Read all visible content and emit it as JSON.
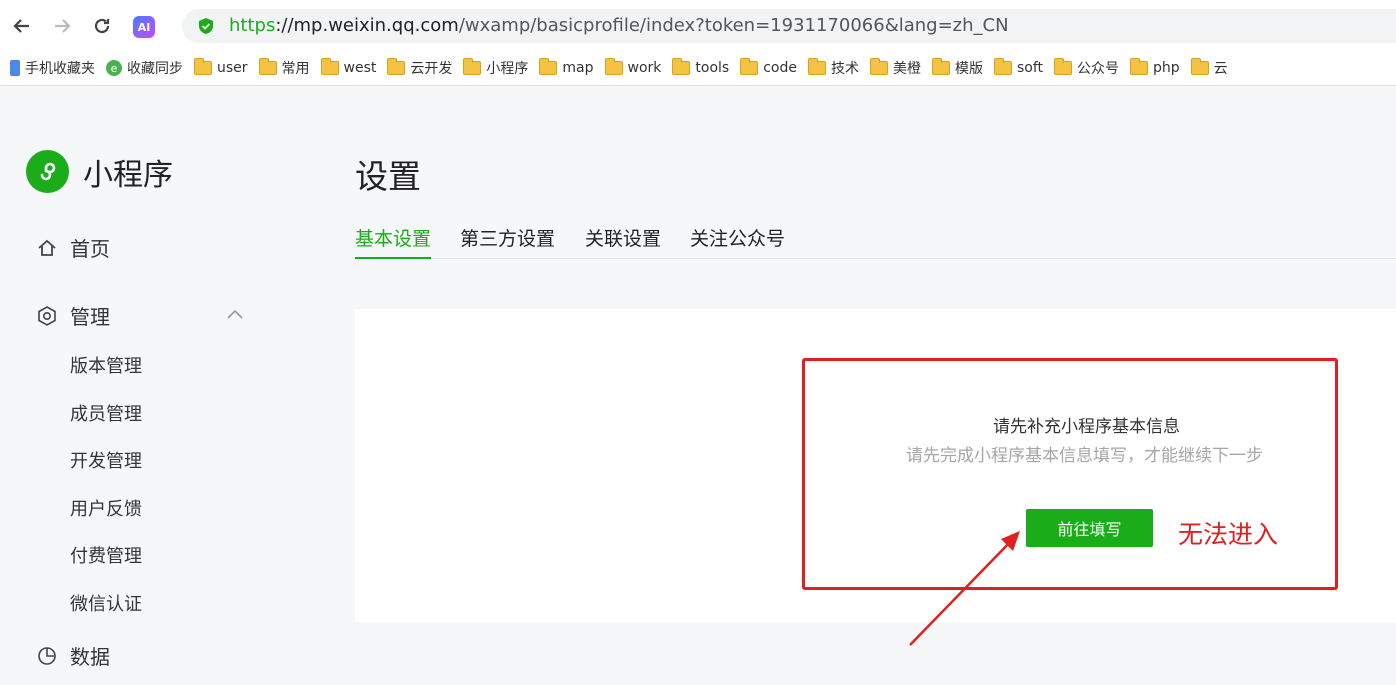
{
  "browser": {
    "url_scheme": "https",
    "url_rest_host": "://mp.weixin.qq.com",
    "url_path": "/wxamp/basicprofile/index?token=1931170066&lang=zh_CN",
    "ai_badge": "AI",
    "bookmarks": [
      {
        "label": "手机收藏夹",
        "icon": "phone-icon"
      },
      {
        "label": "收藏同步",
        "icon": "sync-icon"
      },
      {
        "label": "user",
        "icon": "folder-icon"
      },
      {
        "label": "常用",
        "icon": "folder-icon"
      },
      {
        "label": "west",
        "icon": "folder-icon"
      },
      {
        "label": "云开发",
        "icon": "folder-icon"
      },
      {
        "label": "小程序",
        "icon": "folder-icon"
      },
      {
        "label": "map",
        "icon": "folder-icon"
      },
      {
        "label": "work",
        "icon": "folder-icon"
      },
      {
        "label": "tools",
        "icon": "folder-icon"
      },
      {
        "label": "code",
        "icon": "folder-icon"
      },
      {
        "label": "技术",
        "icon": "folder-icon"
      },
      {
        "label": "美橙",
        "icon": "folder-icon"
      },
      {
        "label": "模版",
        "icon": "folder-icon"
      },
      {
        "label": "soft",
        "icon": "folder-icon"
      },
      {
        "label": "公众号",
        "icon": "folder-icon"
      },
      {
        "label": "php",
        "icon": "folder-icon"
      },
      {
        "label": "云",
        "icon": "folder-icon"
      }
    ]
  },
  "sidebar": {
    "app_name": "小程序",
    "home": "首页",
    "manage": "管理",
    "manage_items": [
      "版本管理",
      "成员管理",
      "开发管理",
      "用户反馈",
      "付费管理",
      "微信认证"
    ],
    "data": "数据"
  },
  "main": {
    "title": "设置",
    "tabs": [
      "基本设置",
      "第三方设置",
      "关联设置",
      "关注公众号"
    ],
    "notice_title": "请先补充小程序基本信息",
    "notice_desc": "请先完成小程序基本信息填写，才能继续下一步",
    "go_button": "前往填写"
  },
  "annotation": {
    "text": "无法进入",
    "color": "#e0201e"
  },
  "colors": {
    "brand_green": "#1aad19"
  }
}
